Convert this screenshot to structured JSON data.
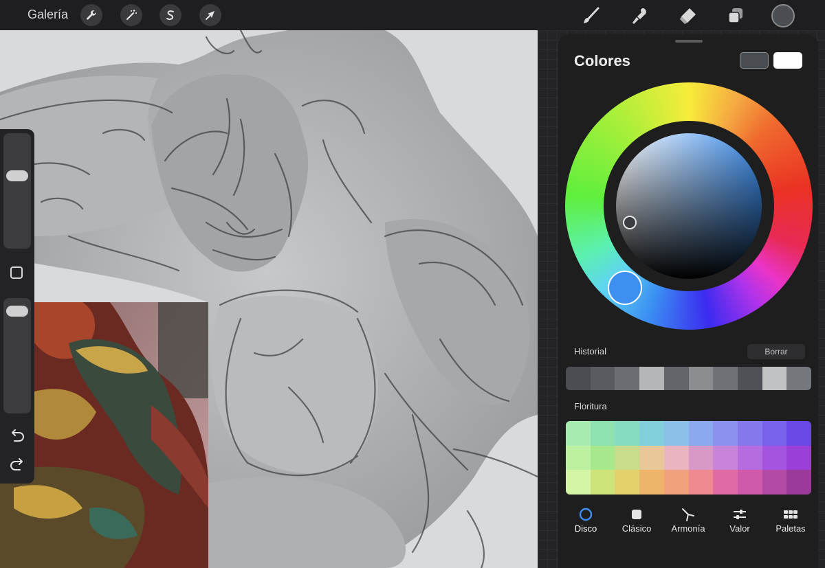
{
  "topbar": {
    "gallery_label": "Galería",
    "left_tools": [
      "wrench-icon",
      "magic-wand-icon",
      "selection-s-icon",
      "arrow-cursor-icon"
    ],
    "right_tools": [
      "brush-icon",
      "smudge-icon",
      "eraser-icon",
      "layers-icon"
    ],
    "current_color": "#4a4d52"
  },
  "colors_panel": {
    "title": "Colores",
    "primary_color": "#4a4d52",
    "secondary_color": "#ffffff",
    "selected_hue_color": "#3d8ff0",
    "history": {
      "label": "Historial",
      "clear_label": "Borrar",
      "swatches": [
        "#4a4e52",
        "#585c60",
        "#6a6e72",
        "#b4b6b8",
        "#62666a",
        "#8a8e90",
        "#6e7276",
        "#4e5256",
        "#c0c2c4",
        "#74787c"
      ]
    },
    "flourish": {
      "label": "Floritura",
      "swatches": [
        "#a8ebb0",
        "#8de2b0",
        "#86dcc0",
        "#82d0dc",
        "#8cc0e8",
        "#8ca8ee",
        "#8c90ee",
        "#8478ec",
        "#7862ea",
        "#6a48e6",
        "#bdf0a0",
        "#a8e88c",
        "#c8dc8c",
        "#e8c898",
        "#eab4c0",
        "#d898c8",
        "#c884d8",
        "#b46ce0",
        "#a454e0",
        "#9a40d8",
        "#d4f6a4",
        "#cce47a",
        "#e4d06c",
        "#eeb46a",
        "#f0a27e",
        "#ee8a90",
        "#e06aa4",
        "#d05aaa",
        "#b44aa6",
        "#9c3a9c"
      ]
    },
    "tabs": [
      {
        "label": "Disco",
        "icon": "disc-icon",
        "active": true
      },
      {
        "label": "Clásico",
        "icon": "classic-square-icon",
        "active": false
      },
      {
        "label": "Armonía",
        "icon": "harmony-icon",
        "active": false
      },
      {
        "label": "Valor",
        "icon": "sliders-icon",
        "active": false
      },
      {
        "label": "Paletas",
        "icon": "palettes-grid-icon",
        "active": false
      }
    ]
  },
  "sidebar": {
    "brush_size_level": 0.65,
    "opacity_level": 0.95,
    "buttons": [
      "modify-square-icon",
      "undo-icon",
      "redo-icon"
    ]
  }
}
